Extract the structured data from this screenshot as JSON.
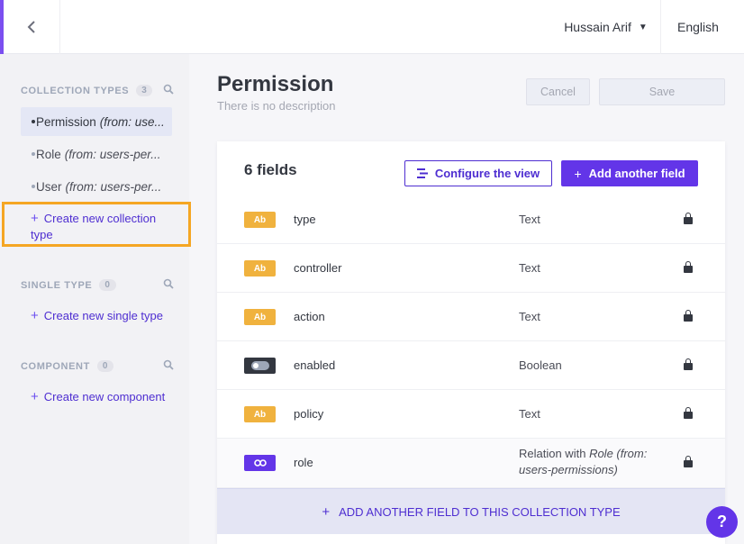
{
  "topbar": {
    "back_icon": "chevron-left-icon",
    "user_name": "Hussain Arif",
    "language": "English"
  },
  "sidebar": {
    "collection_types": {
      "heading": "COLLECTION TYPES",
      "count": "3",
      "items": [
        {
          "name": "Permission",
          "from": "(from: use...",
          "active": true
        },
        {
          "name": "Role",
          "from": "(from: users-per...",
          "active": false
        },
        {
          "name": "User",
          "from": "(from: users-per...",
          "active": false
        }
      ],
      "create_label": "Create new collection type"
    },
    "single_type": {
      "heading": "SINGLE TYPE",
      "count": "0",
      "create_label": "Create new single type"
    },
    "component": {
      "heading": "COMPONENT",
      "count": "0",
      "create_label": "Create new component"
    }
  },
  "header": {
    "title": "Permission",
    "description": "There is no description",
    "cancel_label": "Cancel",
    "save_label": "Save"
  },
  "fields_card": {
    "count_label": "6 fields",
    "configure_label": "Configure the view",
    "add_field_label": "Add another field",
    "fields": [
      {
        "name": "type",
        "type": "Text",
        "icon": "Ab"
      },
      {
        "name": "controller",
        "type": "Text",
        "icon": "Ab"
      },
      {
        "name": "action",
        "type": "Text",
        "icon": "Ab"
      },
      {
        "name": "enabled",
        "type": "Boolean",
        "icon": "toggle"
      },
      {
        "name": "policy",
        "type": "Text",
        "icon": "Ab"
      },
      {
        "name": "role",
        "type_prefix": "Relation with",
        "type_italic": "Role (from:",
        "type_line2": "users-permissions)",
        "icon": "link"
      }
    ],
    "add_collection_field_label": "ADD ANOTHER FIELD TO THIS COLLECTION TYPE"
  },
  "help": {
    "label": "?"
  },
  "colors": {
    "accent": "#6335e8",
    "text_icon": "#f0b23e",
    "highlight": "#f5a623"
  }
}
